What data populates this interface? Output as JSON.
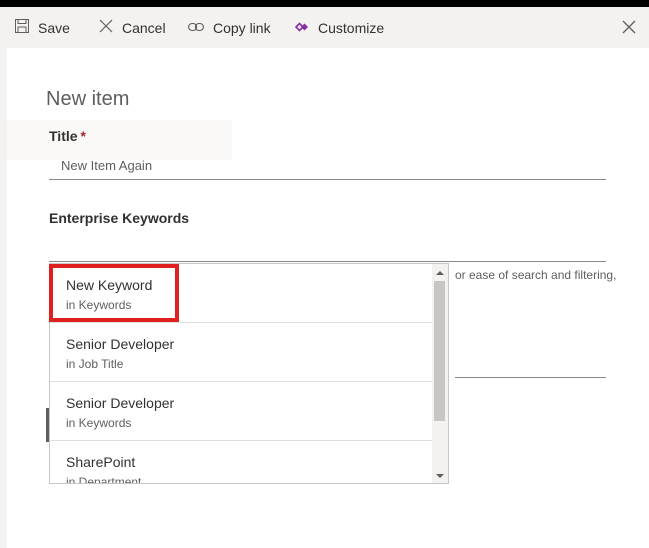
{
  "commandbar": {
    "save": "Save",
    "cancel": "Cancel",
    "copy_link": "Copy link",
    "customize": "Customize"
  },
  "form": {
    "heading": "New item",
    "title_label": "Title",
    "title_required": "*",
    "title_value": "New Item Again",
    "keywords_label": "Enterprise Keywords",
    "keywords_hint": "or ease of search and filtering,"
  },
  "suggestions": [
    {
      "name": "New Keyword",
      "source": "in Keywords"
    },
    {
      "name": "Senior Developer",
      "source": "in Job Title"
    },
    {
      "name": "Senior Developer",
      "source": "in Keywords"
    },
    {
      "name": "SharePoint",
      "source": "in Department"
    }
  ],
  "colors": {
    "highlight": "#e0201f",
    "required": "#a4262c",
    "customize_icon": "#8a2da5"
  },
  "icons": {
    "save": "save-icon",
    "cancel": "cancel-icon",
    "copy_link": "link-icon",
    "customize": "customize-icon",
    "close": "close-icon"
  }
}
